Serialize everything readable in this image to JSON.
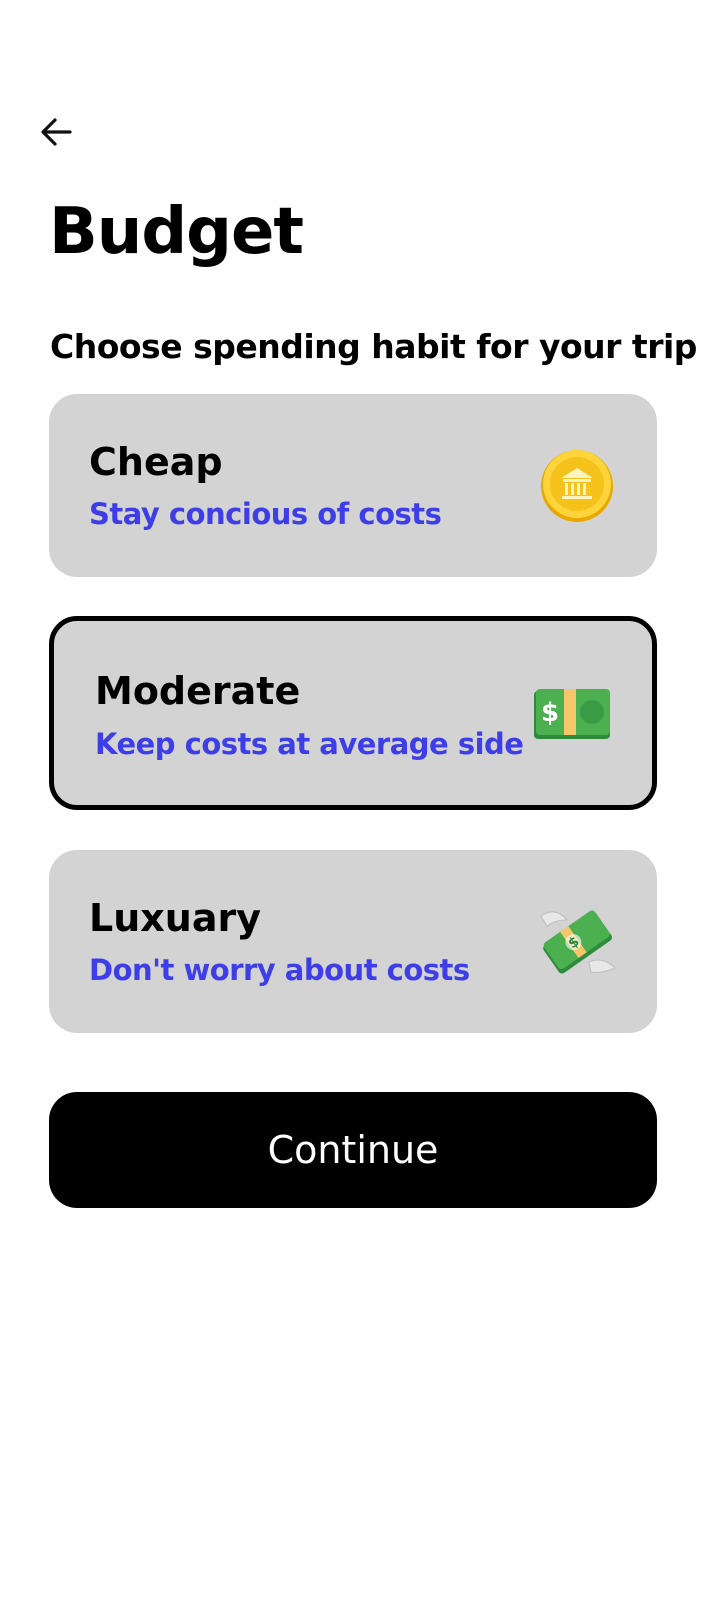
{
  "header": {
    "back_icon": "arrow-left-icon",
    "title": "Budget",
    "subtitle": "Choose spending habit for your trip"
  },
  "options": [
    {
      "title": "Cheap",
      "description": "Stay concious of costs",
      "icon": "coin-icon",
      "selected": false
    },
    {
      "title": "Moderate",
      "description": "Keep costs at average side",
      "icon": "dollar-banknote-icon",
      "selected": true
    },
    {
      "title": "Luxuary",
      "description": "Don't worry about costs",
      "icon": "money-with-wings-icon",
      "selected": false
    }
  ],
  "continue_label": "Continue",
  "colors": {
    "card_background": "#d3d3d3",
    "accent_text": "#3e3ee8",
    "button_background": "#000000",
    "button_text": "#ffffff",
    "selected_border": "#000000"
  }
}
